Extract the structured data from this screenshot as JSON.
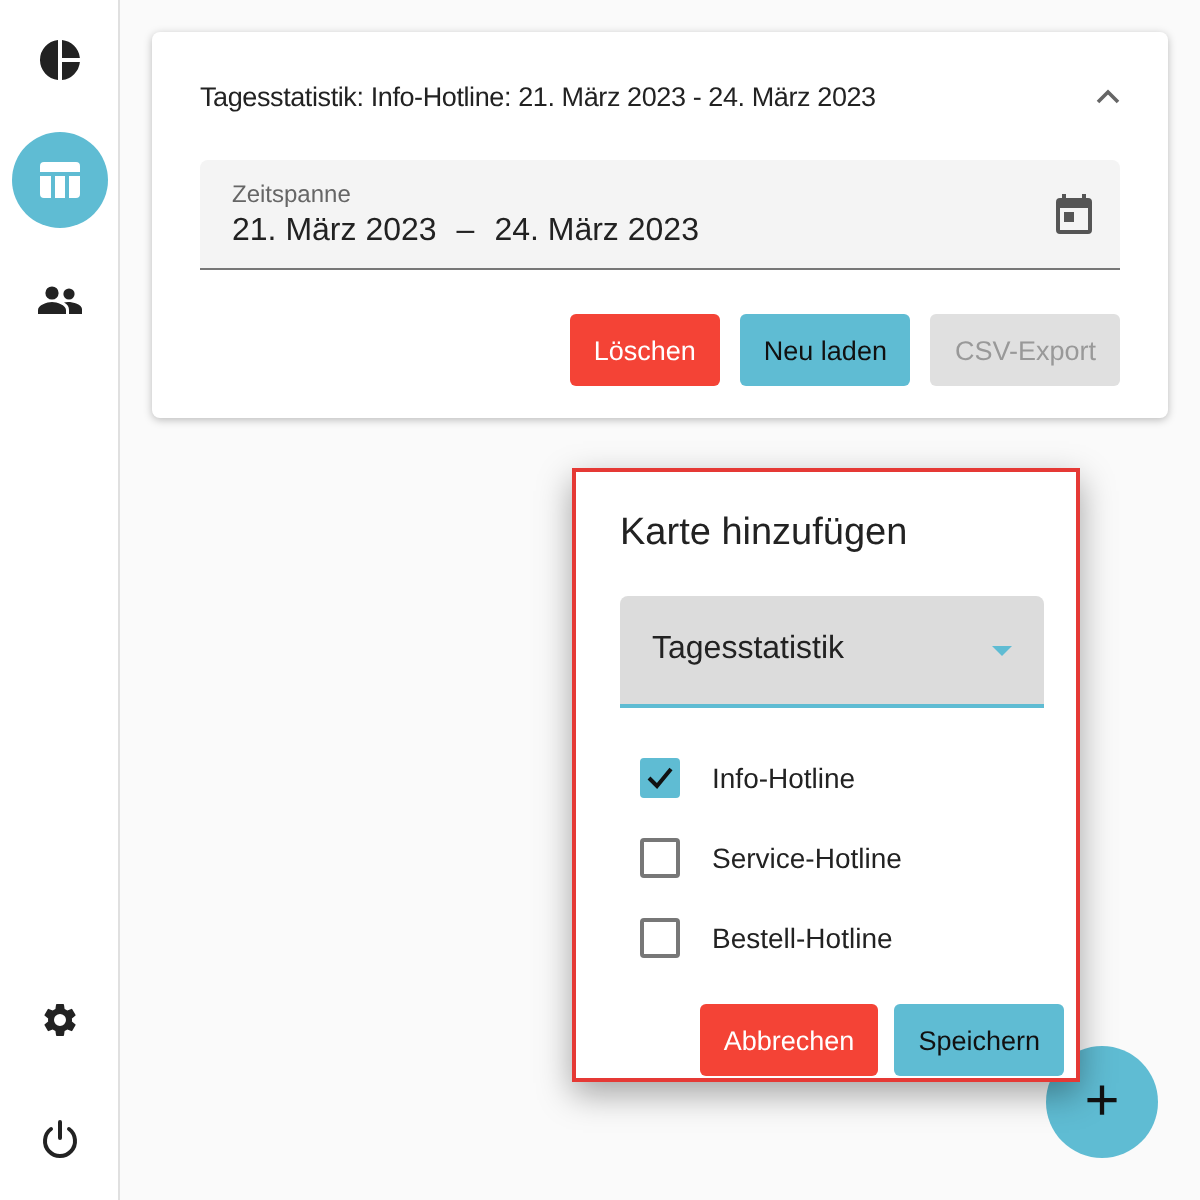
{
  "sidebar": {
    "top_items": [
      {
        "kind": "chart",
        "selected": false
      },
      {
        "kind": "table",
        "selected": true
      },
      {
        "kind": "people",
        "selected": false
      }
    ],
    "bottom_items": [
      {
        "kind": "settings",
        "selected": false
      },
      {
        "kind": "power",
        "selected": false
      }
    ]
  },
  "card": {
    "title": "Tagesstatistik: Info-Hotline: 21. März 2023 - 24. März 2023",
    "expanded": true,
    "date_field": {
      "label": "Zeitspanne",
      "start": "21. März 2023",
      "separator": "–",
      "end": "24. März 2023"
    },
    "buttons": [
      {
        "label": "Löschen",
        "kind": "danger",
        "disabled": false
      },
      {
        "label": "Neu laden",
        "kind": "primary",
        "disabled": false
      },
      {
        "label": "CSV-Export",
        "disabled": true
      }
    ]
  },
  "dialog": {
    "title": "Karte hinzufügen",
    "select": {
      "value": "Tagesstatistik"
    },
    "options": [
      {
        "label": "Info-Hotline",
        "checked": true
      },
      {
        "label": "Service-Hotline",
        "checked": false
      },
      {
        "label": "Bestell-Hotline",
        "checked": false
      }
    ],
    "buttons": [
      {
        "label": "Abbrechen",
        "kind": "danger",
        "disabled": false
      },
      {
        "label": "Speichern",
        "kind": "primary",
        "disabled": false
      }
    ]
  },
  "fab": {
    "label": "+"
  }
}
